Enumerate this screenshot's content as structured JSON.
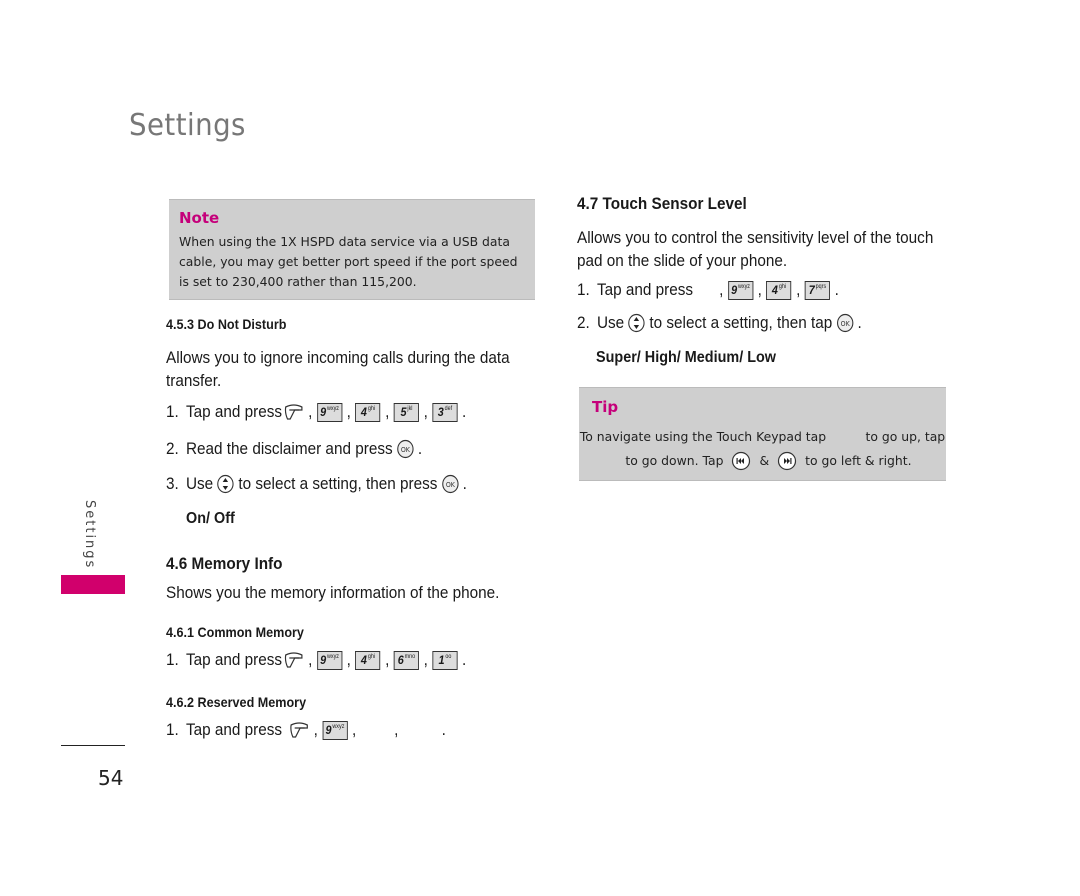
{
  "page": {
    "title": "Settings",
    "side_label": "Settings",
    "number": "54",
    "accent_color": "#d1006c"
  },
  "note": {
    "title": "Note",
    "text": "When using the 1X HSPD data service via a USB data cable, you may get better port speed if the port speed is set to 230,400 rather than 115,200."
  },
  "do_not_disturb": {
    "heading": "4.5.3 Do Not Disturb",
    "description": "Allows you to ignore incoming calls during the data transfer.",
    "step1": {
      "num": "1.",
      "text": "Tap and press",
      "keys": [
        {
          "n": "9",
          "l": "wxyz"
        },
        {
          "n": "4",
          "l": "ghi"
        },
        {
          "n": "5",
          "l": "jkl"
        },
        {
          "n": "3",
          "l": "def"
        }
      ]
    },
    "step2": {
      "num": "2.",
      "text": "Read the disclaimer and press"
    },
    "step3": {
      "num": "3.",
      "text_a": "Use",
      "text_b": "to select a setting, then press"
    },
    "options": "On/ Off"
  },
  "memory_info": {
    "heading": "4.6 Memory Info",
    "description": "Shows you the memory information of the phone.",
    "common": {
      "heading": "4.6.1 Common Memory",
      "step1": {
        "num": "1.",
        "text": "Tap and press",
        "keys": [
          {
            "n": "9",
            "l": "wxyz"
          },
          {
            "n": "4",
            "l": "ghi"
          },
          {
            "n": "6",
            "l": "mno"
          },
          {
            "n": "1",
            "l": "oo"
          }
        ]
      }
    },
    "reserved": {
      "heading": "4.6.2 Reserved Memory",
      "step1": {
        "num": "1.",
        "text": "Tap and press",
        "keys": [
          {
            "n": "9",
            "l": "wxyz"
          }
        ]
      }
    }
  },
  "touch_sensor": {
    "heading": "4.7 Touch Sensor Level",
    "description": "Allows you to control the sensitivity level of the touch pad on the slide of your phone.",
    "step1": {
      "num": "1.",
      "text": "Tap and press",
      "keys": [
        {
          "n": "9",
          "l": "wxyz"
        },
        {
          "n": "4",
          "l": "ghi"
        },
        {
          "n": "7",
          "l": "pqrs"
        }
      ]
    },
    "step2": {
      "num": "2.",
      "text_a": "Use",
      "text_b": "to select a setting, then tap"
    },
    "options": "Super/ High/ Medium/ Low"
  },
  "tip": {
    "title": "Tip",
    "line1": "To navigate using the Touch Keypad tap          to go up, tap",
    "line2_a": "to go down. Tap",
    "line2_b": "&",
    "line2_c": "to go left & right."
  },
  "icons": {
    "menu": "menu-softkey-icon",
    "ok": "ok-button-icon",
    "nav": "up-down-navigation-icon",
    "rewind": "rewind-icon",
    "forward": "fast-forward-icon"
  }
}
